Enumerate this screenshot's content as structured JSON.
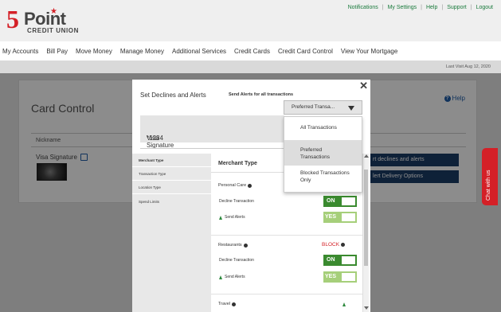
{
  "header": {
    "logo_number": "5",
    "logo_word": "Point",
    "logo_sub": "CREDIT UNION",
    "links": [
      "Notifications",
      "My Settings",
      "Help",
      "Support",
      "Logout"
    ]
  },
  "nav": [
    "My Accounts",
    "Bill Pay",
    "Move Money",
    "Manage Money",
    "Additional Services",
    "Credit Cards",
    "Credit Card Control",
    "View Your Mortgage"
  ],
  "last_visit": "Last Visit Aug 12, 2020",
  "card_control": {
    "title": "Card Control",
    "help": "Help",
    "nickname_header": "Nickname",
    "card_name": "Visa Signature",
    "buttons": [
      "rt declines and alerts",
      "lert Delivery Options"
    ]
  },
  "chat": "Chat with us",
  "modal": {
    "title": "Set Declines and Alerts",
    "alert_label": "Send Alerts for all transactions",
    "selected_option": "Preferred Transa...",
    "card_label": "Visa Signature",
    "card_number": "*1234",
    "side_items": [
      "Merchant Type",
      "Transaction Type",
      "Location Type",
      "Spend Limits"
    ],
    "content_header": "Merchant Type",
    "categories": [
      {
        "name": "Personal Care",
        "decline_label": "Decline Transaction",
        "decline_value": "ON",
        "alerts_label": "Send Alerts",
        "alerts_value": "YES"
      },
      {
        "name": "Restaurants",
        "status": "BLOCK",
        "decline_label": "Decline Transaction",
        "decline_value": "ON",
        "alerts_label": "Send Alerts",
        "alerts_value": "YES"
      },
      {
        "name": "Travel"
      }
    ]
  },
  "dropdown": {
    "options": [
      "All Transactions",
      "Preferred Transactions",
      "Blocked Transactions Only"
    ],
    "selected_index": 1
  },
  "colors": {
    "brand_red": "#d42027",
    "link_green": "#1a7a3c",
    "toggle_green": "#3a8a2f",
    "toggle_light_green": "#a6cf7a",
    "button_navy": "#1b3c66"
  }
}
